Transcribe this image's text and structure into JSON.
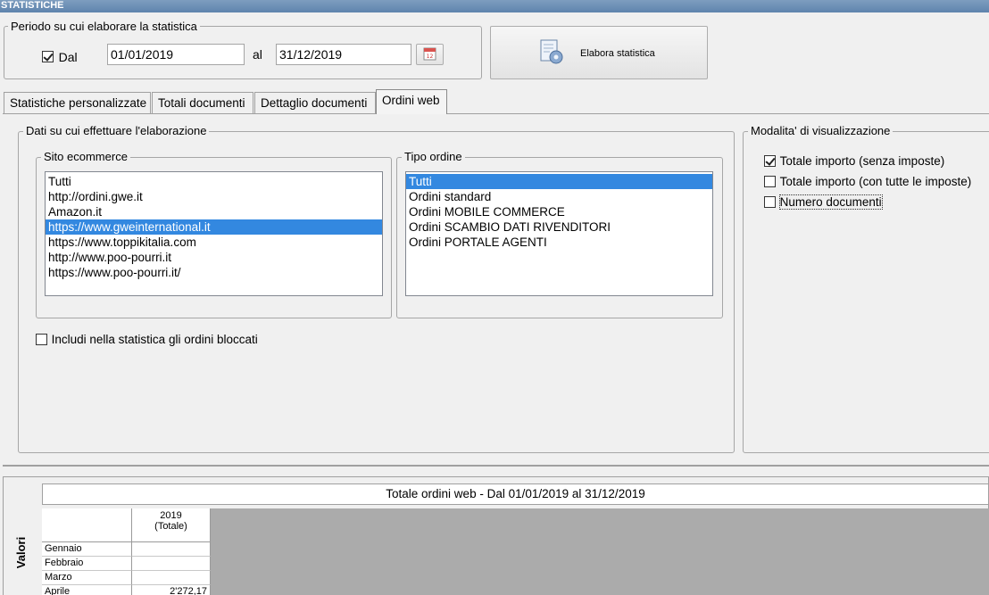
{
  "window": {
    "title": "STATISTICHE"
  },
  "period": {
    "legend": "Periodo su cui elaborare la statistica",
    "from_checkbox_label": "Dal",
    "from_checked": true,
    "from_value": "01/01/2019",
    "to_label": "al",
    "to_value": "31/12/2019",
    "calendar_icon": "calendar-icon"
  },
  "elabora_button": {
    "label": "Elabora statistica",
    "icon": "gear-document-icon"
  },
  "tabs": [
    {
      "label": "Statistiche personalizzate",
      "active": false
    },
    {
      "label": "Totali documenti",
      "active": false
    },
    {
      "label": "Dettaglio documenti",
      "active": false
    },
    {
      "label": "Ordini web",
      "active": true
    }
  ],
  "dati": {
    "legend": "Dati su cui effettuare l'elaborazione",
    "sito": {
      "legend": "Sito ecommerce",
      "items": [
        "Tutti",
        "http://ordini.gwe.it",
        "Amazon.it",
        "https://www.gweinternational.it",
        "https://www.toppikitalia.com",
        "http://www.poo-pourri.it",
        "https://www.poo-pourri.it/"
      ],
      "selected_index": 3
    },
    "tipo": {
      "legend": "Tipo ordine",
      "items": [
        "Tutti",
        "Ordini standard",
        "Ordini MOBILE COMMERCE",
        "Ordini SCAMBIO DATI RIVENDITORI",
        "Ordini PORTALE AGENTI"
      ],
      "selected_index": 0
    },
    "includi_bloccati": {
      "label": "Includi nella statistica gli ordini bloccati",
      "checked": false
    }
  },
  "modalita": {
    "legend": "Modalita' di visualizzazione",
    "options": [
      {
        "label": "Totale importo (senza imposte)",
        "checked": true
      },
      {
        "label": "Totale importo (con tutte le imposte)",
        "checked": false
      },
      {
        "label": "Numero documenti",
        "checked": false
      }
    ]
  },
  "pivot": {
    "side_label": "Valori",
    "title": "Totale ordini web - Dal 01/01/2019 al 31/12/2019",
    "column_header": "2019\n(Totale)",
    "rows": [
      {
        "month": "Gennaio",
        "value": ""
      },
      {
        "month": "Febbraio",
        "value": ""
      },
      {
        "month": "Marzo",
        "value": ""
      },
      {
        "month": "Aprile",
        "value": "2'272,17"
      }
    ]
  }
}
